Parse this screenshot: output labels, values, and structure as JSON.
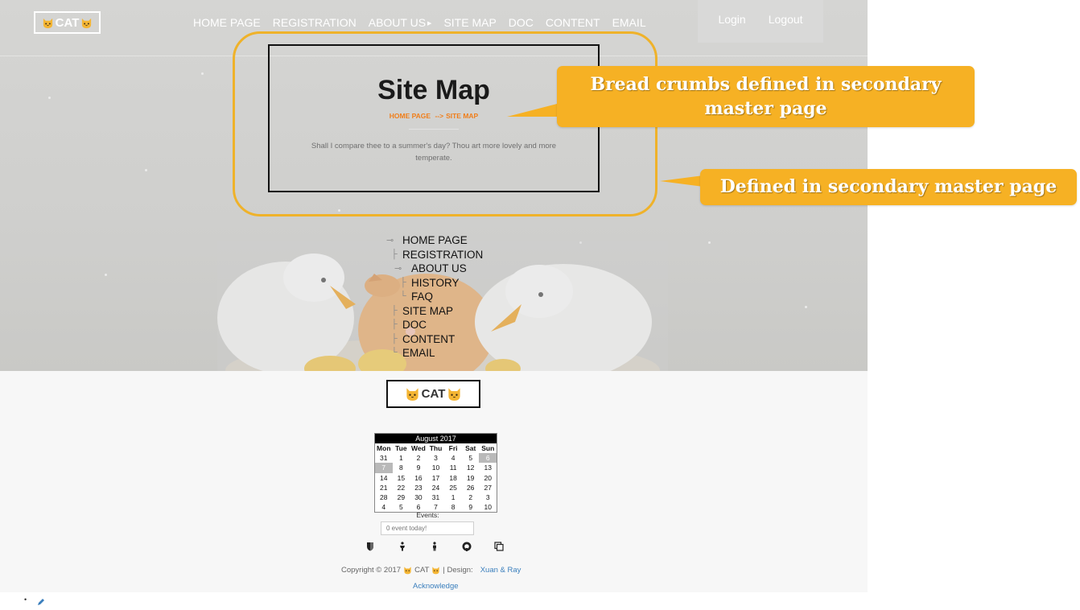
{
  "header": {
    "logo_text": "CAT",
    "nav": [
      {
        "label": "HOME PAGE"
      },
      {
        "label": "REGISTRATION"
      },
      {
        "label": "ABOUT US"
      },
      {
        "label": "SITE MAP"
      },
      {
        "label": "DOC"
      },
      {
        "label": "CONTENT"
      },
      {
        "label": "EMAIL"
      }
    ],
    "login_label": "Login",
    "logout_label": "Logout"
  },
  "banner": {
    "title": "Site Map",
    "breadcrumb": {
      "home": "HOME PAGE",
      "separator": "-->",
      "current": "SITE MAP"
    },
    "quote": "Shall I compare thee to a summer's day? Thou art more lovely and more temperate."
  },
  "annotations": {
    "callout_1": "Bread crumbs defined in secondary master page",
    "callout_2": "Defined in secondary master page"
  },
  "sitemap_tree": [
    {
      "label": "HOME PAGE"
    },
    {
      "label": "REGISTRATION"
    },
    {
      "label": "ABOUT US"
    },
    {
      "label": "HISTORY"
    },
    {
      "label": "FAQ"
    },
    {
      "label": "SITE MAP"
    },
    {
      "label": "DOC"
    },
    {
      "label": "CONTENT"
    },
    {
      "label": "EMAIL"
    }
  ],
  "footer": {
    "logo_text": "CAT",
    "calendar": {
      "title": "August 2017",
      "days_of_week": [
        "Mon",
        "Tue",
        "Wed",
        "Thu",
        "Fri",
        "Sat",
        "Sun"
      ],
      "weeks": [
        [
          "31",
          "1",
          "2",
          "3",
          "4",
          "5",
          "6"
        ],
        [
          "7",
          "8",
          "9",
          "10",
          "11",
          "12",
          "13"
        ],
        [
          "14",
          "15",
          "16",
          "17",
          "18",
          "19",
          "20"
        ],
        [
          "21",
          "22",
          "23",
          "24",
          "25",
          "26",
          "27"
        ],
        [
          "28",
          "29",
          "30",
          "31",
          "1",
          "2",
          "3"
        ],
        [
          "4",
          "5",
          "6",
          "7",
          "8",
          "9",
          "10"
        ]
      ]
    },
    "events_label": "Events:",
    "events_value": "0 event today!",
    "copyright_prefix": "Copyright © 2017",
    "copyright_brand": "CAT",
    "design_label": "| Design:",
    "design_link": "Xuan & Ray",
    "acknowledge_link": "Acknowledge"
  },
  "colors": {
    "accent_orange": "#f07e1a",
    "callout_yellow": "#f6b124",
    "link_blue": "#3b7fbd"
  }
}
